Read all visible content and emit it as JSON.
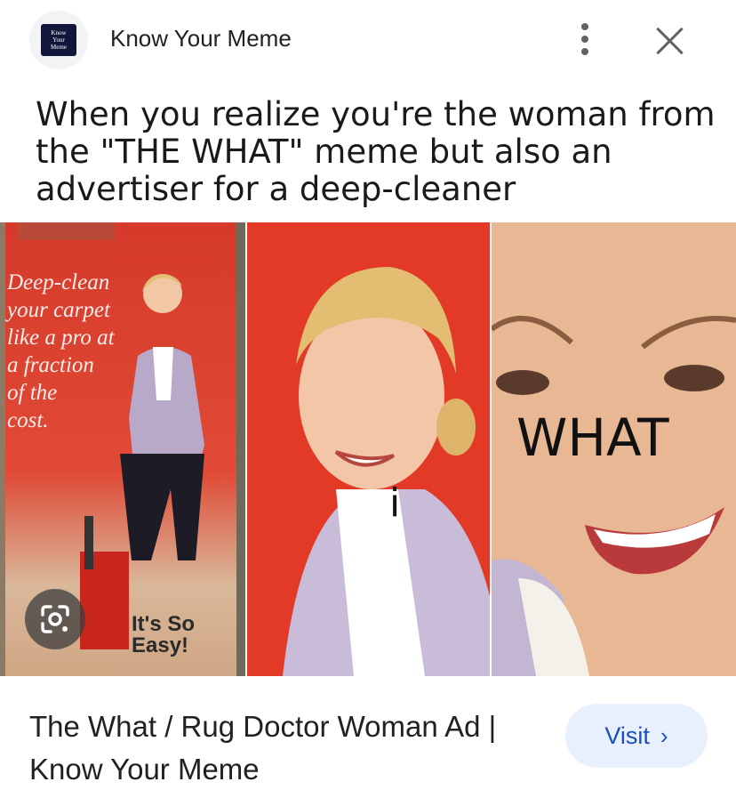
{
  "header": {
    "logo_text": "Know\nYour\nMeme",
    "site_name": "Know Your Meme"
  },
  "meme": {
    "caption": "When you realize you're the woman from the \"THE WHAT\" meme but also an advertiser for a deep-cleaner",
    "ad_text": [
      "Deep-clean",
      "your carpet",
      "like a pro at",
      "a fraction",
      "of the",
      "cost."
    ],
    "easy_text": [
      "It's So",
      "Easy!"
    ],
    "panel2_label": "i",
    "panel3_label": "WHAT"
  },
  "footer": {
    "title": "The What / Rug Doctor Woman Ad | Know Your Meme",
    "visit_label": "Visit",
    "visit_chevron": "›"
  },
  "icons": {
    "lens": "google-lens-icon",
    "more": "more-vert-icon",
    "close": "close-icon"
  },
  "colors": {
    "accent": "#1a4fbf",
    "visit_bg": "#e8f0fe",
    "ad_red": "#e33a27"
  }
}
